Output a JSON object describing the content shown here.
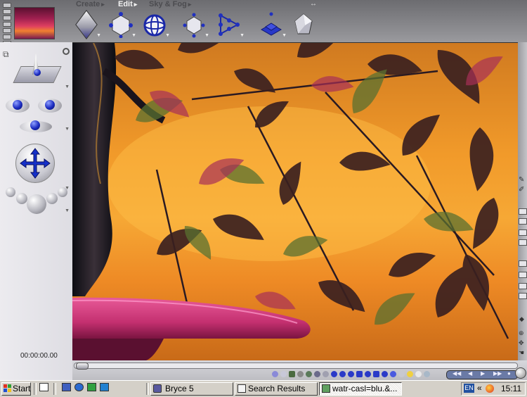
{
  "palette": {
    "tabs": [
      {
        "label": "Create",
        "active": false
      },
      {
        "label": "Edit",
        "active": true
      },
      {
        "label": "Sky & Fog",
        "active": false
      }
    ],
    "resize_glyph": "↔"
  },
  "tools": {
    "icons": [
      "object-attributes-cube-icon",
      "scale-move-icon",
      "rotate-sphere-icon",
      "repeat-transform-icon",
      "path-align-icon",
      "terrain-blocks-icon",
      "rock-editor-icon"
    ]
  },
  "left_controls": {
    "time_display": "00:00:00.00"
  },
  "taskbar": {
    "start_label": "Start",
    "tasks": [
      {
        "label": "Bryce 5",
        "pressed": false
      },
      {
        "label": "Search Results",
        "pressed": false
      },
      {
        "label": "watr-casl=blu.&...",
        "pressed": true
      }
    ],
    "tray": {
      "language": "EN",
      "chevron": "«",
      "clock": "15:11"
    }
  },
  "colors": {
    "sky_top": "#d07a20",
    "sky_mid": "#f6a835",
    "accent_blue": "#1b2bc0",
    "platform_pink": "#d8407a",
    "taskbar_gray": "#d4d0c8"
  }
}
